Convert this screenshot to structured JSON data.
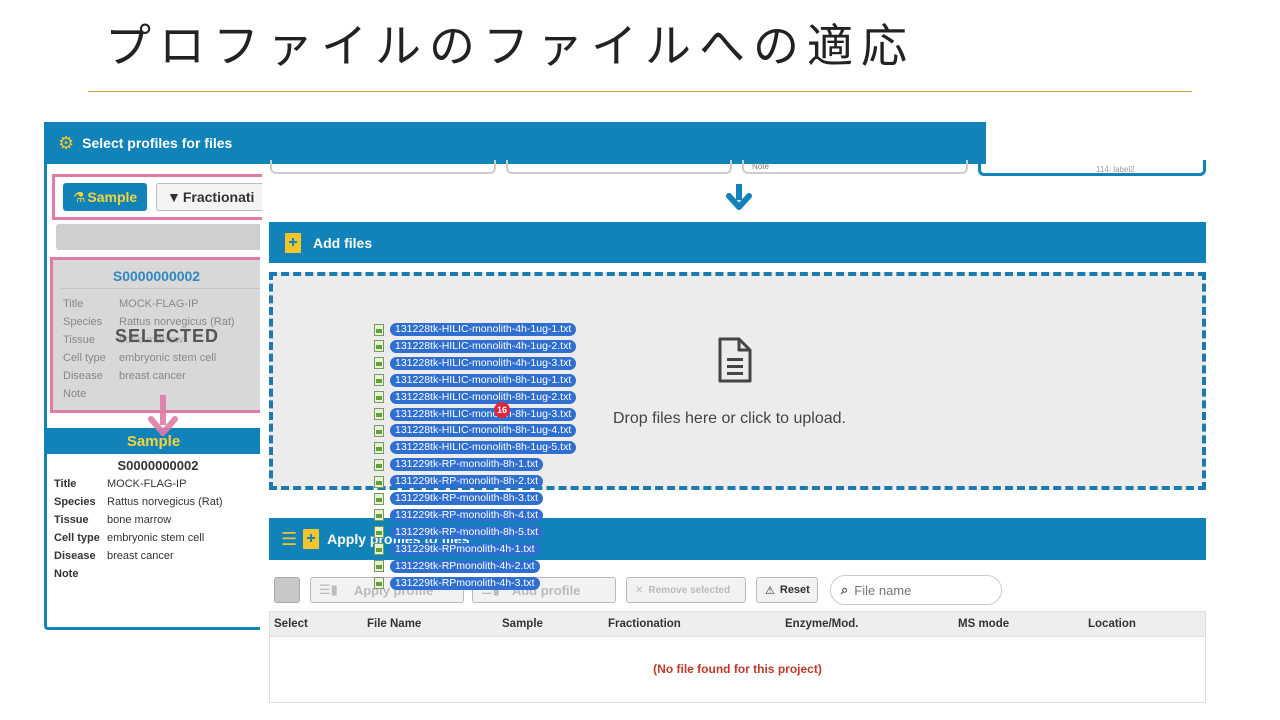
{
  "slide": {
    "title": "プロファイルのファイルへの適応"
  },
  "left_panel": {
    "header": "Select profiles for files",
    "tabs": {
      "sample": "Sample",
      "fractionation": "Fractionati"
    },
    "selected_card": {
      "id": "S0000000002",
      "overlay": "SELECTED",
      "fields": [
        {
          "k": "Title",
          "v": "MOCK-FLAG-IP"
        },
        {
          "k": "Species",
          "v": "Rattus norvegicus (Rat)"
        },
        {
          "k": "Tissue",
          "v": "bone marrow"
        },
        {
          "k": "Cell type",
          "v": "embryonic stem cell"
        },
        {
          "k": "Disease",
          "v": "breast cancer"
        },
        {
          "k": "Note",
          "v": ""
        }
      ]
    },
    "sample_detail": {
      "heading": "Sample",
      "id": "S0000000002",
      "fields": [
        {
          "k": "Title",
          "v": "MOCK-FLAG-IP"
        },
        {
          "k": "Species",
          "v": "Rattus norvegicus (Rat)"
        },
        {
          "k": "Tissue",
          "v": "bone marrow"
        },
        {
          "k": "Cell type",
          "v": "embryonic stem cell"
        },
        {
          "k": "Disease",
          "v": "breast cancer"
        },
        {
          "k": "Note",
          "v": ""
        }
      ]
    }
  },
  "top_boxes": {
    "note_label": "Note",
    "right_text": "114: label2"
  },
  "add_files": {
    "header": "Add files",
    "drop_text": "Drop files here or click to upload."
  },
  "dragged_files": {
    "count_badge": "16",
    "files": [
      "131228tk-HILIC-monolith-4h-1ug-1.txt",
      "131228tk-HILIC-monolith-4h-1ug-2.txt",
      "131228tk-HILIC-monolith-4h-1ug-3.txt",
      "131228tk-HILIC-monolith-8h-1ug-1.txt",
      "131228tk-HILIC-monolith-8h-1ug-2.txt",
      "131228tk-HILIC-monolith-8h-1ug-3.txt",
      "131228tk-HILIC-monolith-8h-1ug-4.txt",
      "131228tk-HILIC-monolith-8h-1ug-5.txt",
      "131229tk-RP-monolith-8h-1.txt",
      "131229tk-RP-monolith-8h-2.txt",
      "131229tk-RP-monolith-8h-3.txt",
      "131229tk-RP-monolith-8h-4.txt",
      "131229tk-RP-monolith-8h-5.txt",
      "131229tk-RPmonolith-4h-1.txt",
      "131229tk-RPmonolith-4h-2.txt",
      "131229tk-RPmonolith-4h-3.txt"
    ]
  },
  "apply": {
    "header": "Apply profiles to files",
    "buttons": {
      "apply": "Apply profile",
      "add": "Add profile",
      "remove": "Remove selected",
      "reset": "Reset"
    },
    "search_placeholder": "File name",
    "columns": [
      "Select",
      "File Name",
      "Sample",
      "Fractionation",
      "Enzyme/Mod.",
      "MS mode",
      "Location"
    ],
    "empty": "(No file found for this project)"
  }
}
